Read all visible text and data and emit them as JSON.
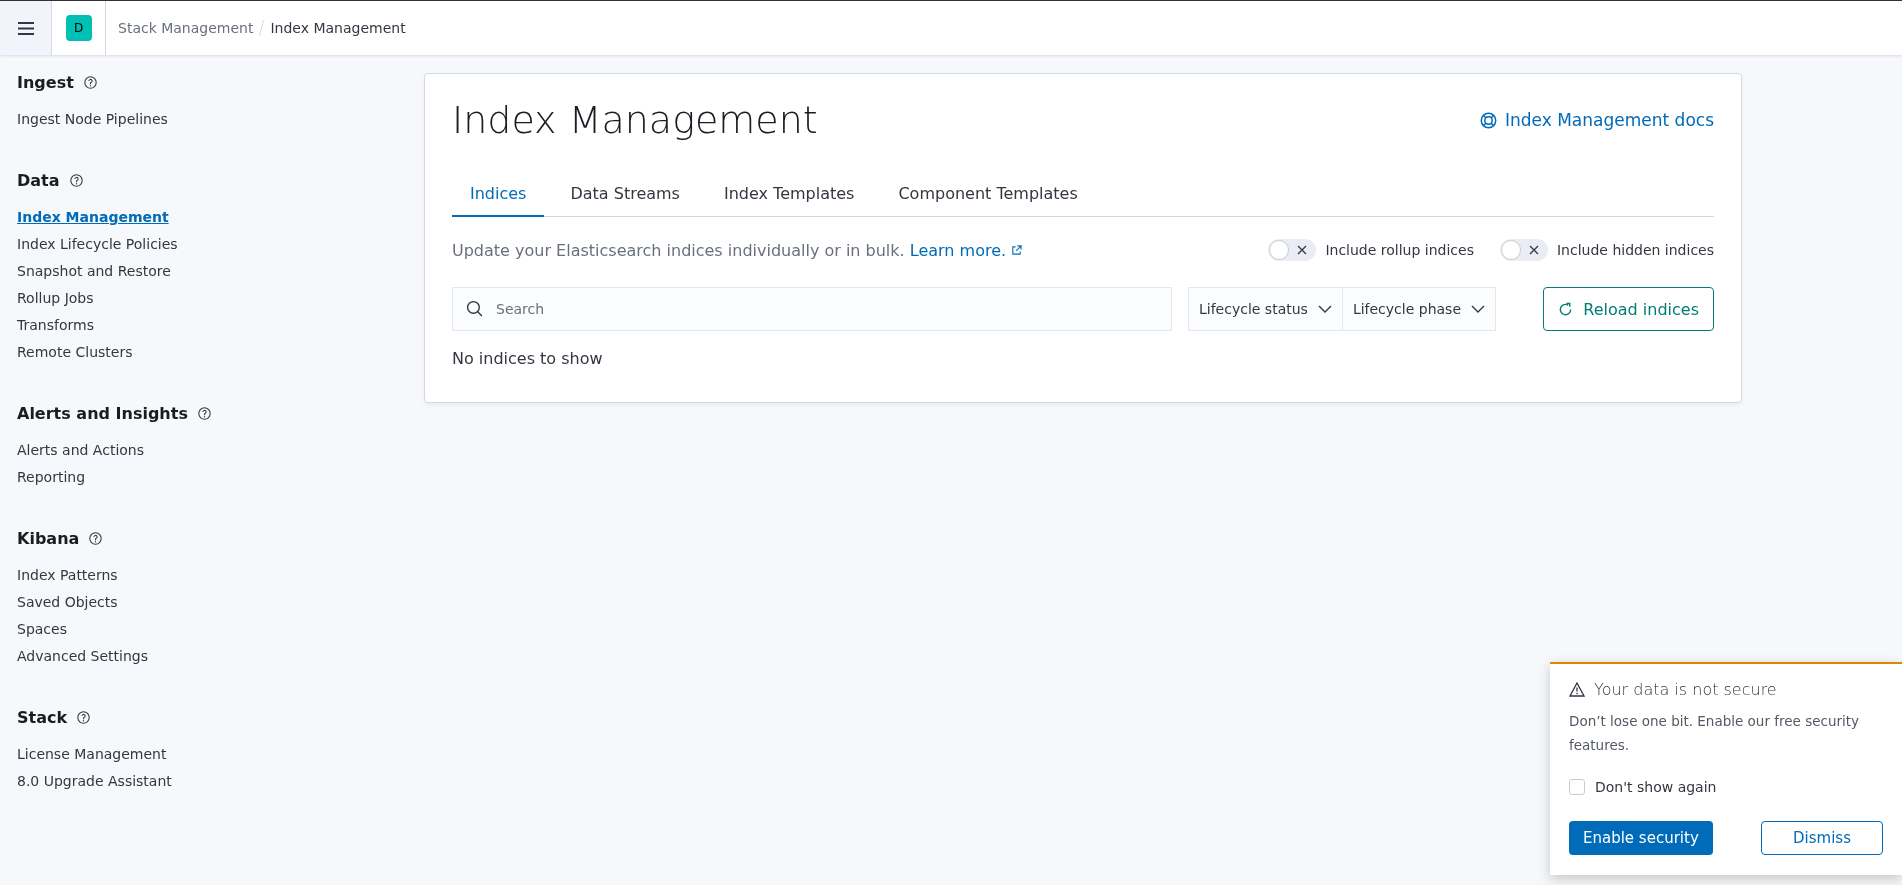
{
  "header": {
    "space_initial": "D",
    "breadcrumbs": [
      {
        "label": "Stack Management",
        "current": false
      },
      {
        "label": "Index Management",
        "current": true
      }
    ]
  },
  "sidebar": {
    "sections": [
      {
        "title": "Ingest",
        "items": [
          {
            "label": "Ingest Node Pipelines",
            "selected": false
          }
        ]
      },
      {
        "title": "Data",
        "items": [
          {
            "label": "Index Management",
            "selected": true
          },
          {
            "label": "Index Lifecycle Policies",
            "selected": false
          },
          {
            "label": "Snapshot and Restore",
            "selected": false
          },
          {
            "label": "Rollup Jobs",
            "selected": false
          },
          {
            "label": "Transforms",
            "selected": false
          },
          {
            "label": "Remote Clusters",
            "selected": false
          }
        ]
      },
      {
        "title": "Alerts and Insights",
        "items": [
          {
            "label": "Alerts and Actions",
            "selected": false
          },
          {
            "label": "Reporting",
            "selected": false
          }
        ]
      },
      {
        "title": "Kibana",
        "items": [
          {
            "label": "Index Patterns",
            "selected": false
          },
          {
            "label": "Saved Objects",
            "selected": false
          },
          {
            "label": "Spaces",
            "selected": false
          },
          {
            "label": "Advanced Settings",
            "selected": false
          }
        ]
      },
      {
        "title": "Stack",
        "items": [
          {
            "label": "License Management",
            "selected": false
          },
          {
            "label": "8.0 Upgrade Assistant",
            "selected": false
          }
        ]
      }
    ]
  },
  "panel": {
    "title": "Index Management",
    "docs_link": "Index Management docs",
    "tabs": [
      {
        "label": "Indices",
        "selected": true
      },
      {
        "label": "Data Streams",
        "selected": false
      },
      {
        "label": "Index Templates",
        "selected": false
      },
      {
        "label": "Component Templates",
        "selected": false
      }
    ],
    "description": "Update your Elasticsearch indices individually or in bulk.",
    "learn_more": "Learn more.",
    "switches": [
      {
        "label": "Include rollup indices",
        "on": false
      },
      {
        "label": "Include hidden indices",
        "on": false
      }
    ],
    "search": {
      "placeholder": "Search"
    },
    "filters": [
      "Lifecycle status",
      "Lifecycle phase"
    ],
    "reload_button": "Reload indices",
    "empty_message": "No indices to show"
  },
  "toast": {
    "title": "Your data is not secure",
    "body": "Don’t lose one bit. Enable our free security features.",
    "checkbox": {
      "label": "Don't show again",
      "checked": false
    },
    "primary_button": "Enable security",
    "secondary_button": "Dismiss"
  }
}
